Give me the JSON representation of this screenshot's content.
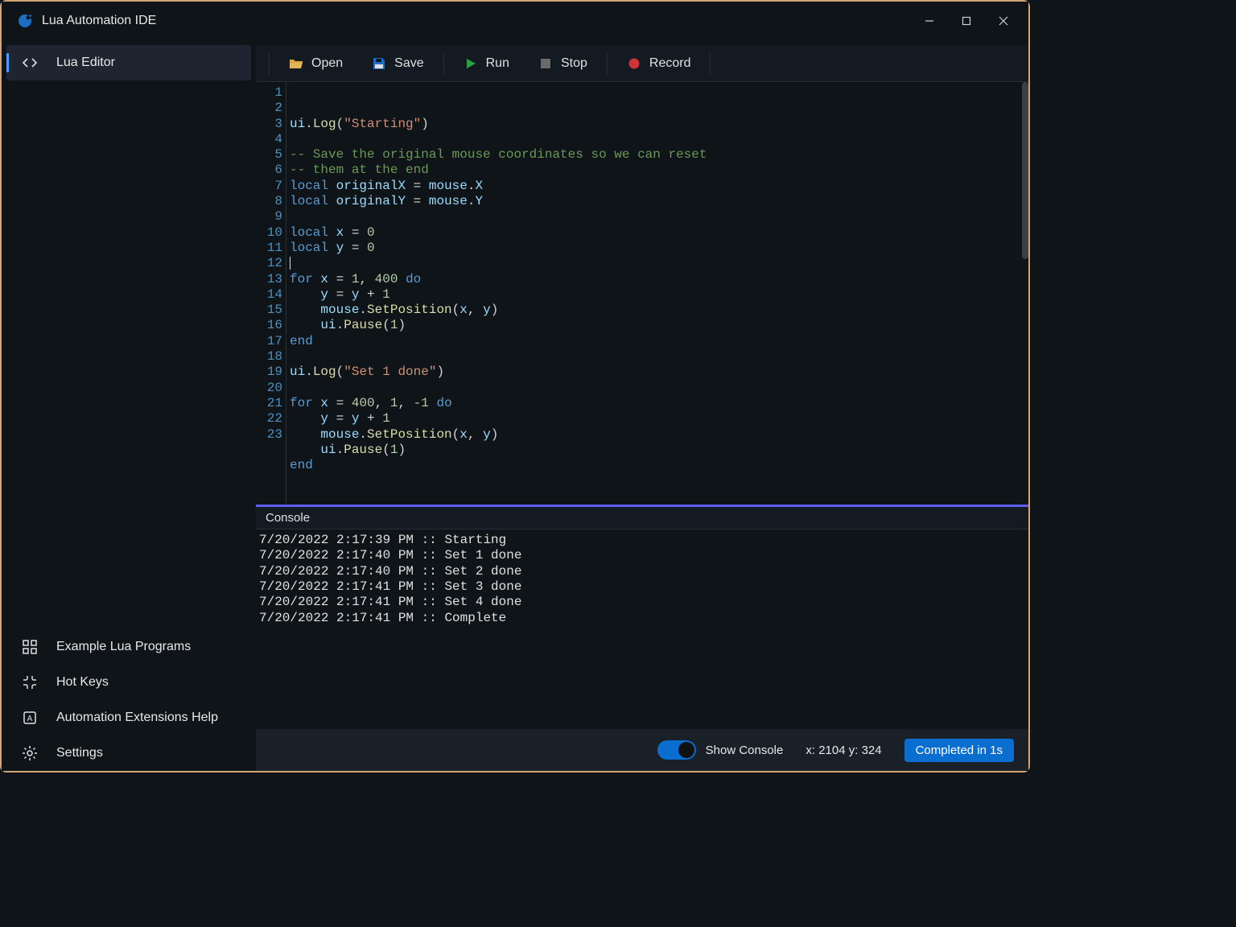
{
  "titlebar": {
    "title": "Lua Automation IDE"
  },
  "sidebar": {
    "main_item": "Lua Editor",
    "footer_items": [
      "Example Lua Programs",
      "Hot Keys",
      "Automation Extensions Help",
      "Settings"
    ]
  },
  "toolbar": {
    "open": "Open",
    "save": "Save",
    "run": "Run",
    "stop": "Stop",
    "record": "Record"
  },
  "code_lines": [
    [
      [
        "id",
        "ui"
      ],
      [
        "op",
        "."
      ],
      [
        "fn",
        "Log"
      ],
      [
        "op",
        "("
      ],
      [
        "str",
        "\"Starting\""
      ],
      [
        "op",
        ")"
      ]
    ],
    [],
    [
      [
        "cm",
        "-- Save the original mouse coordinates so we can reset"
      ]
    ],
    [
      [
        "cm",
        "-- them at the end"
      ]
    ],
    [
      [
        "kw",
        "local"
      ],
      [
        "op",
        " "
      ],
      [
        "id",
        "originalX"
      ],
      [
        "op",
        " = "
      ],
      [
        "id",
        "mouse"
      ],
      [
        "op",
        "."
      ],
      [
        "id",
        "X"
      ]
    ],
    [
      [
        "kw",
        "local"
      ],
      [
        "op",
        " "
      ],
      [
        "id",
        "originalY"
      ],
      [
        "op",
        " = "
      ],
      [
        "id",
        "mouse"
      ],
      [
        "op",
        "."
      ],
      [
        "id",
        "Y"
      ]
    ],
    [],
    [
      [
        "kw",
        "local"
      ],
      [
        "op",
        " "
      ],
      [
        "id",
        "x"
      ],
      [
        "op",
        " = "
      ],
      [
        "num",
        "0"
      ]
    ],
    [
      [
        "kw",
        "local"
      ],
      [
        "op",
        " "
      ],
      [
        "id",
        "y"
      ],
      [
        "op",
        " = "
      ],
      [
        "num",
        "0"
      ]
    ],
    [
      [
        "cursor",
        ""
      ]
    ],
    [
      [
        "kw",
        "for"
      ],
      [
        "op",
        " "
      ],
      [
        "id",
        "x"
      ],
      [
        "op",
        " = "
      ],
      [
        "num",
        "1"
      ],
      [
        "op",
        ", "
      ],
      [
        "num",
        "400"
      ],
      [
        "op",
        " "
      ],
      [
        "kw",
        "do"
      ]
    ],
    [
      [
        "op",
        "    "
      ],
      [
        "id",
        "y"
      ],
      [
        "op",
        " = "
      ],
      [
        "id",
        "y"
      ],
      [
        "op",
        " + "
      ],
      [
        "num",
        "1"
      ]
    ],
    [
      [
        "op",
        "    "
      ],
      [
        "id",
        "mouse"
      ],
      [
        "op",
        "."
      ],
      [
        "fn",
        "SetPosition"
      ],
      [
        "op",
        "("
      ],
      [
        "id",
        "x"
      ],
      [
        "op",
        ", "
      ],
      [
        "id",
        "y"
      ],
      [
        "op",
        ")"
      ]
    ],
    [
      [
        "op",
        "    "
      ],
      [
        "id",
        "ui"
      ],
      [
        "op",
        "."
      ],
      [
        "fn",
        "Pause"
      ],
      [
        "op",
        "("
      ],
      [
        "num",
        "1"
      ],
      [
        "op",
        ")"
      ]
    ],
    [
      [
        "kw",
        "end"
      ]
    ],
    [],
    [
      [
        "id",
        "ui"
      ],
      [
        "op",
        "."
      ],
      [
        "fn",
        "Log"
      ],
      [
        "op",
        "("
      ],
      [
        "str",
        "\"Set 1 done\""
      ],
      [
        "op",
        ")"
      ]
    ],
    [],
    [
      [
        "kw",
        "for"
      ],
      [
        "op",
        " "
      ],
      [
        "id",
        "x"
      ],
      [
        "op",
        " = "
      ],
      [
        "num",
        "400"
      ],
      [
        "op",
        ", "
      ],
      [
        "num",
        "1"
      ],
      [
        "op",
        ", "
      ],
      [
        "num",
        "-1"
      ],
      [
        "op",
        " "
      ],
      [
        "kw",
        "do"
      ]
    ],
    [
      [
        "op",
        "    "
      ],
      [
        "id",
        "y"
      ],
      [
        "op",
        " = "
      ],
      [
        "id",
        "y"
      ],
      [
        "op",
        " + "
      ],
      [
        "num",
        "1"
      ]
    ],
    [
      [
        "op",
        "    "
      ],
      [
        "id",
        "mouse"
      ],
      [
        "op",
        "."
      ],
      [
        "fn",
        "SetPosition"
      ],
      [
        "op",
        "("
      ],
      [
        "id",
        "x"
      ],
      [
        "op",
        ", "
      ],
      [
        "id",
        "y"
      ],
      [
        "op",
        ")"
      ]
    ],
    [
      [
        "op",
        "    "
      ],
      [
        "id",
        "ui"
      ],
      [
        "op",
        "."
      ],
      [
        "fn",
        "Pause"
      ],
      [
        "op",
        "("
      ],
      [
        "num",
        "1"
      ],
      [
        "op",
        ")"
      ]
    ],
    [
      [
        "kw",
        "end"
      ]
    ]
  ],
  "console": {
    "header": "Console",
    "lines": [
      "7/20/2022 2:17:39 PM :: Starting",
      "7/20/2022 2:17:40 PM :: Set 1 done",
      "7/20/2022 2:17:40 PM :: Set 2 done",
      "7/20/2022 2:17:41 PM :: Set 3 done",
      "7/20/2022 2:17:41 PM :: Set 4 done",
      "7/20/2022 2:17:41 PM :: Complete"
    ]
  },
  "statusbar": {
    "show_console": "Show Console",
    "coords": "x: 2104 y: 324",
    "status": "Completed in 1s"
  }
}
